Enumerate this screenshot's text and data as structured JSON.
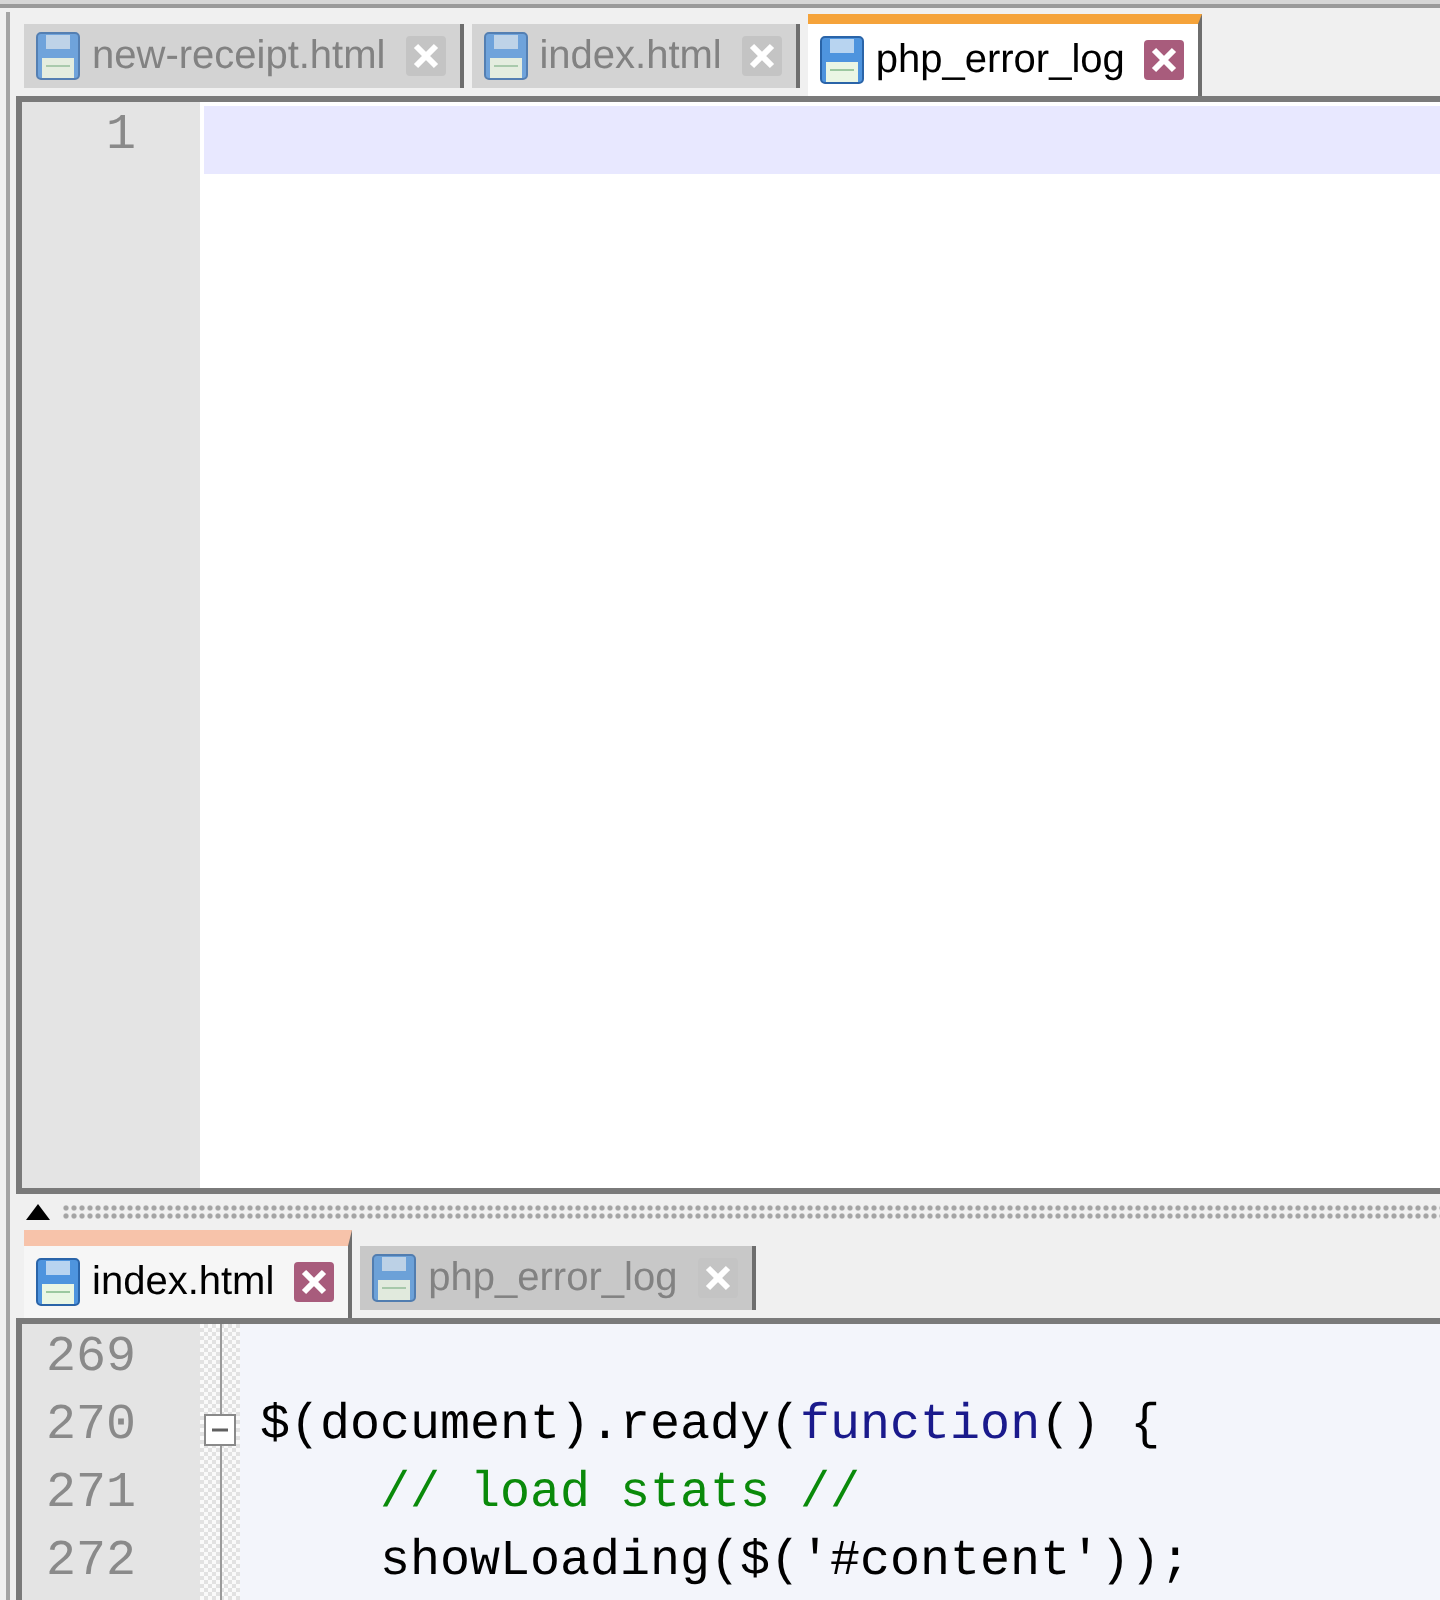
{
  "panes": [
    {
      "focused": true,
      "tabs": [
        {
          "label": "new-receipt.html",
          "selected": false
        },
        {
          "label": "index.html",
          "selected": false
        },
        {
          "label": "php_error_log",
          "selected": true
        }
      ],
      "editor": {
        "lines": [
          {
            "number": "1",
            "current": true
          }
        ]
      }
    },
    {
      "focused": false,
      "tabs": [
        {
          "label": "index.html",
          "selected": true
        },
        {
          "label": "php_error_log",
          "selected": false
        }
      ],
      "editor": {
        "fold_margin": true,
        "lines": [
          {
            "number": "269",
            "current": false
          },
          {
            "number": "270",
            "current": false,
            "fold": {
              "expanded": true
            },
            "tokens": [
              {
                "text": "$(document).ready(",
                "kind": "plain"
              },
              {
                "text": "function",
                "kind": "keyword"
              },
              {
                "text": "() {",
                "kind": "plain"
              }
            ]
          },
          {
            "number": "271",
            "current": false,
            "tokens": [
              {
                "text": "    // load stats //",
                "kind": "comment"
              }
            ]
          },
          {
            "number": "272",
            "current": false,
            "tokens": [
              {
                "text": "    showLoading($('#content'));",
                "kind": "plain"
              }
            ]
          }
        ]
      }
    }
  ]
}
